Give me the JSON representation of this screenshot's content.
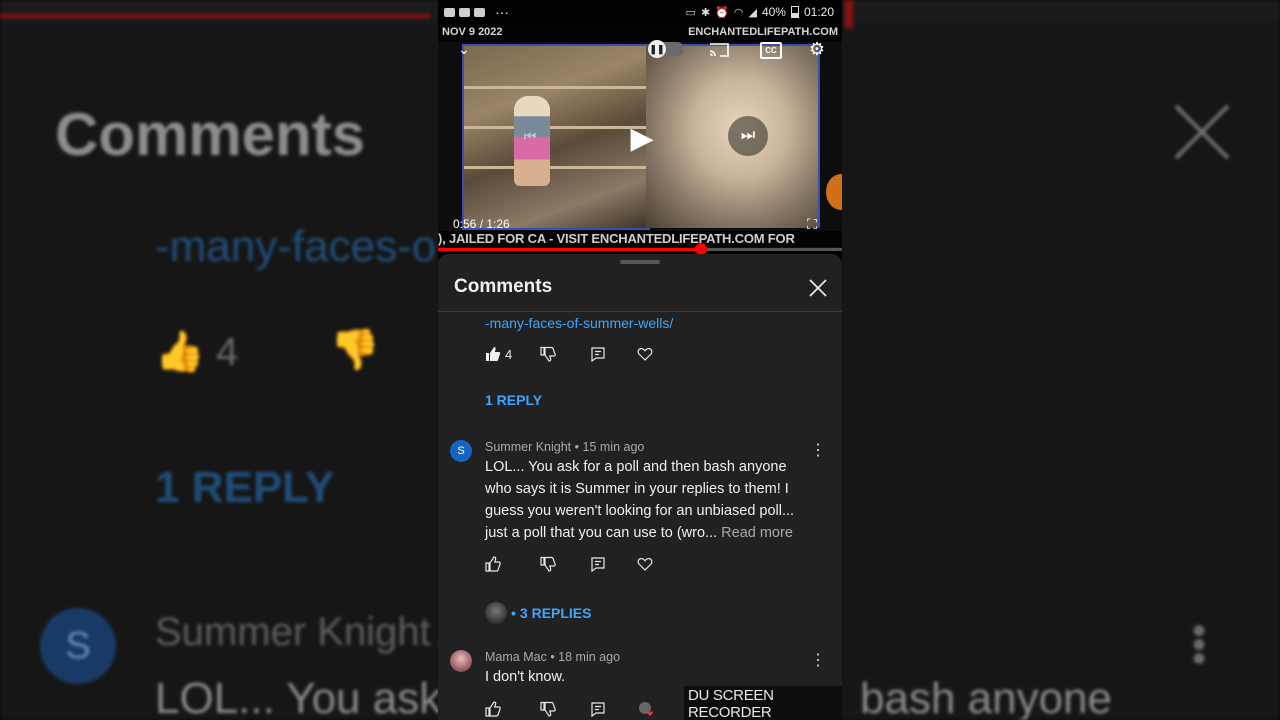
{
  "background": {
    "title": "Comments",
    "link_fragment": "-many-faces-o",
    "like_count": "4",
    "reply_label": "1 REPLY",
    "avatar_letter": "S",
    "author": "Summer Knight",
    "line_start": "LOL... You ask",
    "line_end": "bash anyone"
  },
  "status_bar": {
    "battery": "40%",
    "time": "01:20"
  },
  "video": {
    "date_overlay": "NOV 9 2022",
    "site_overlay": "ENCHANTEDLIFEPATH.COM",
    "time_current": "0:56",
    "time_total": "1:26",
    "ticker_text": "), JAILED FOR CA - VISIT ENCHANTEDLIFEPATH.COM FOR",
    "progress_fraction": 0.651,
    "cc_label": "CC"
  },
  "comments_panel": {
    "title": "Comments",
    "first_comment": {
      "link_text": "-many-faces-of-summer-wells/",
      "like_count": "4",
      "replies_label": "1 REPLY"
    },
    "comments": [
      {
        "avatar_letter": "S",
        "author": "Summer Knight",
        "time": "15 min ago",
        "body_lines": [
          "LOL... You ask for a poll and then bash anyone",
          "who says it is Summer in your replies to them! I",
          "guess you weren't looking for an unbiased poll...",
          "just a poll that you can use to (wro..."
        ],
        "read_more": "Read more",
        "replies_label": "3 REPLIES"
      },
      {
        "author": "Mama Mac",
        "time": "18 min ago",
        "body": "I don't know."
      }
    ]
  },
  "watermark": "DU SCREEN RECORDER",
  "colors": {
    "link_blue": "#3ea6ff",
    "sheet_bg": "#212121",
    "progress_red": "#ff0000"
  }
}
